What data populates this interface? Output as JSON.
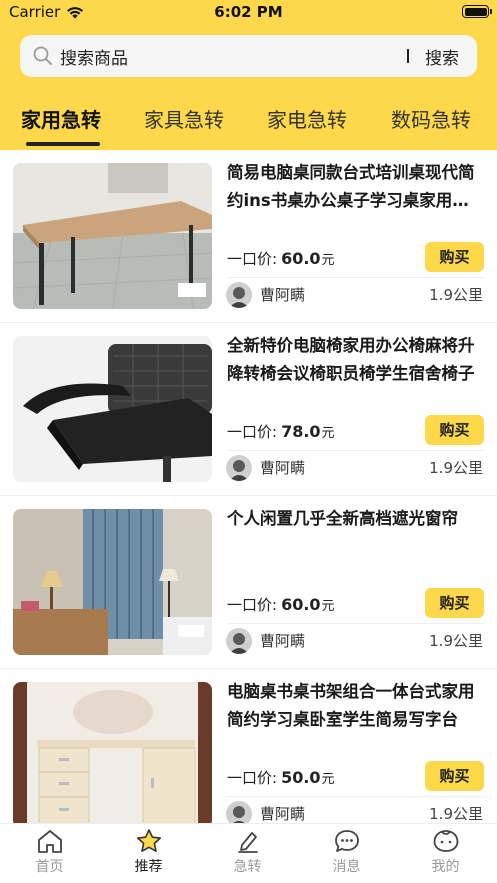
{
  "status_bar": {
    "carrier": "Carrier",
    "time": "6:02 PM"
  },
  "search": {
    "placeholder": "搜索商品",
    "button_label": "搜索"
  },
  "category_tabs": [
    {
      "label": "家用急转",
      "active": true
    },
    {
      "label": "家具急转",
      "active": false
    },
    {
      "label": "家电急转",
      "active": false
    },
    {
      "label": "数码急转",
      "active": false
    }
  ],
  "listings": [
    {
      "title": "简易电脑桌同款台式培训桌现代简约ins书桌办公桌子学习桌家用卧室",
      "price_label": "一口价:",
      "price": "60.0",
      "unit": "元",
      "buy_label": "购买",
      "seller": "曹阿瞒",
      "distance": "1.9公里",
      "image": "desk-photo"
    },
    {
      "title": "全新特价电脑椅家用办公椅麻将升降转椅会议椅职员椅学生宿舍椅子",
      "price_label": "一口价:",
      "price": "78.0",
      "unit": "元",
      "buy_label": "购买",
      "seller": "曹阿瞒",
      "distance": "1.9公里",
      "image": "office-chair-photo"
    },
    {
      "title": "个人闲置几乎全新高档遮光窗帘",
      "price_label": "一口价:",
      "price": "60.0",
      "unit": "元",
      "buy_label": "购买",
      "seller": "曹阿瞒",
      "distance": "1.9公里",
      "image": "curtain-photo"
    },
    {
      "title": "电脑桌书桌书架组合一体台式家用简约学习桌卧室学生简易写字台",
      "price_label": "一口价:",
      "price": "50.0",
      "unit": "元",
      "buy_label": "购买",
      "seller": "曹阿瞒",
      "distance": "1.9公里",
      "image": "bookcase-desk-photo"
    }
  ],
  "tab_bar": [
    {
      "label": "首页",
      "icon": "home-icon",
      "active": false
    },
    {
      "label": "推荐",
      "icon": "star-icon",
      "active": true
    },
    {
      "label": "急转",
      "icon": "edit-icon",
      "active": false
    },
    {
      "label": "消息",
      "icon": "message-icon",
      "active": false
    },
    {
      "label": "我的",
      "icon": "profile-face-icon",
      "active": false
    }
  ],
  "colors": {
    "accent": "#FCD84A",
    "text": "#222222",
    "muted": "#999999"
  }
}
